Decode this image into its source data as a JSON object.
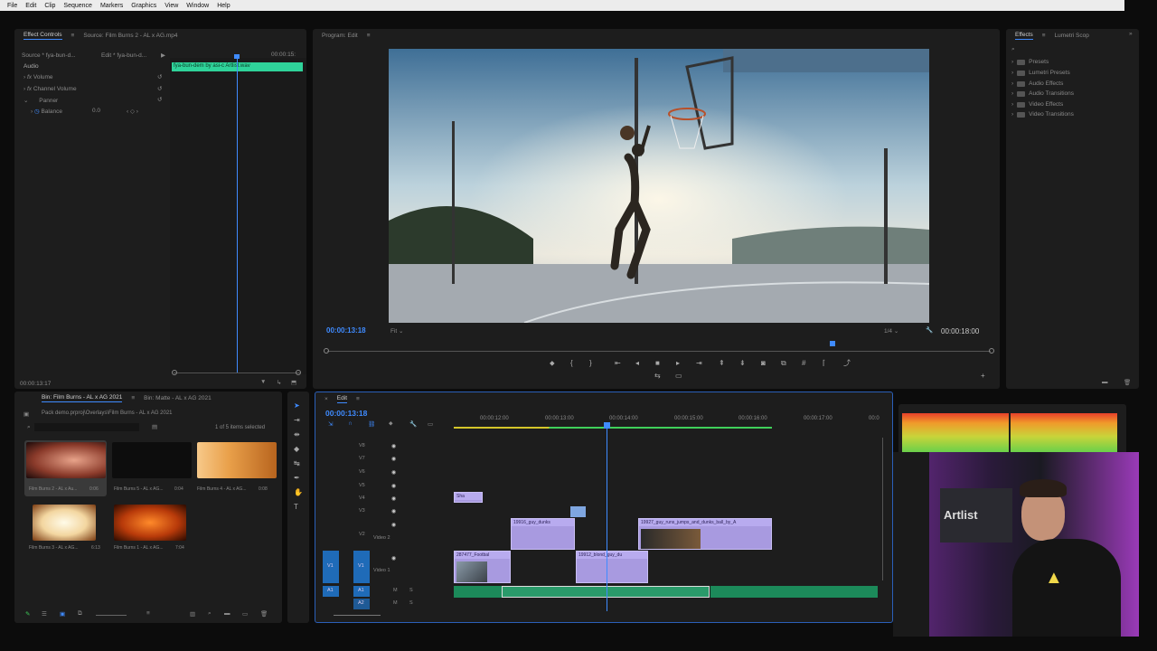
{
  "menu": [
    "File",
    "Edit",
    "Clip",
    "Sequence",
    "Markers",
    "Graphics",
    "View",
    "Window",
    "Help"
  ],
  "effect_controls": {
    "tab": "Effect Controls",
    "source_tab": "Source: Film Burns 2 - AL x AG.mp4",
    "source_dropdown": "Source * fya-bun-d...",
    "edit_dropdown": "Edit * fya-bun-d...",
    "timecode_mini": "00:00:15:",
    "clip_name": "fya-bun-dem by asi-c Artlist.wav",
    "section": "Audio",
    "rows": [
      "Volume",
      "Channel Volume",
      "Panner",
      "Balance"
    ],
    "balance_value": "0.0",
    "current_time": "00:00:13:17"
  },
  "program": {
    "title": "Program: Edit",
    "timecode": "00:00:13:18",
    "fit": "Fit",
    "quality": "1/4",
    "duration": "00:00:18:00"
  },
  "effects": {
    "tabs": [
      "Effects",
      "Lumetri Scop"
    ],
    "items": [
      "Presets",
      "Lumetri Presets",
      "Audio Effects",
      "Audio Transitions",
      "Video Effects",
      "Video Transitions"
    ]
  },
  "project": {
    "tabs": [
      "Bin: Film Burns - AL x AG 2021",
      "Bin: Matte - AL x AG 2021"
    ],
    "path": "Pack demo.prproj\\Overlays\\Film Burns - AL x AG 2021",
    "selection": "1 of 5 items selected",
    "items": [
      {
        "name": "Film Burns 2 - AL x Au...",
        "dur": "0:06"
      },
      {
        "name": "Film Burns 5 - AL x AG...",
        "dur": "0:04"
      },
      {
        "name": "Film Burns 4 - AL x AG...",
        "dur": "0:08"
      },
      {
        "name": "Film Burns 3 - AL x AG...",
        "dur": "6:13"
      },
      {
        "name": "Film Burns 1 - AL x AG...",
        "dur": "7:04"
      }
    ]
  },
  "timeline": {
    "tab": "Edit",
    "timecode": "00:00:13:18",
    "ruler": [
      "00:00:12:00",
      "00:00:13:00",
      "00:00:14:00",
      "00:00:15:00",
      "00:00:16:00",
      "00:00:17:00",
      "00:0"
    ],
    "tracks": [
      "V8",
      "V7",
      "V6",
      "V5",
      "V4",
      "V3",
      "V2",
      "V1",
      "A1",
      "A2"
    ],
    "track_names": {
      "v2": "Video 2",
      "v1": "Video 1"
    },
    "clips": {
      "v4": "Sha",
      "v2a": "19916_guy_dunks",
      "v2b": "19927_guy_runs_jumps_and_dunks_ball_by_A",
      "v1a": "287477_Footbal",
      "v1b": "19912_blond_guy_du"
    },
    "ms": [
      "M",
      "S"
    ]
  },
  "webcam": {
    "brand": "Artlist"
  }
}
